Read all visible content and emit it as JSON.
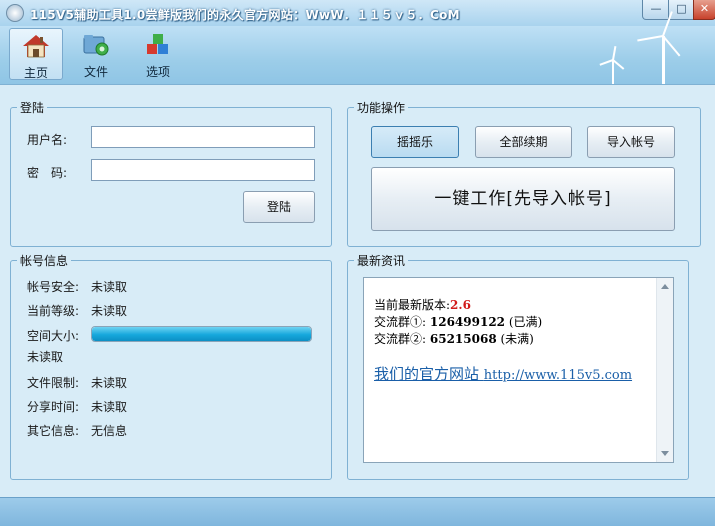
{
  "window": {
    "title": "115V5辅助工具1.0尝鲜版我们的永久官方网站：WwW．１１５ｖ５．CoM",
    "min_label": "—",
    "max_label": "□",
    "close_label": "✕"
  },
  "toolbar": {
    "items": [
      {
        "label": "主页",
        "icon": "house-icon",
        "active": true
      },
      {
        "label": "文件",
        "icon": "folder-gear-icon",
        "active": false
      },
      {
        "label": "选项",
        "icon": "blocks-icon",
        "active": false
      }
    ]
  },
  "login": {
    "title": "登陆",
    "username_label": "用户名:",
    "username_value": "",
    "password_label": "密　码:",
    "password_value": "",
    "login_button": "登陆"
  },
  "functions": {
    "title": "功能操作",
    "shake_button": "摇摇乐",
    "renew_all_button": "全部续期",
    "import_button": "导入帐号",
    "one_click_button": "一键工作[先导入帐号]"
  },
  "account": {
    "title": "帐号信息",
    "security_label": "帐号安全:",
    "security_value": "未读取",
    "level_label": "当前等级:",
    "level_value": "未读取",
    "space_label": "空间大小:",
    "space_value": "未读取",
    "space_progress": 1.0,
    "file_limit_label": "文件限制:",
    "file_limit_value": "未读取",
    "share_time_label": "分享时间:",
    "share_time_value": "未读取",
    "other_label": "其它信息:",
    "other_value": "无信息"
  },
  "news": {
    "title": "最新资讯",
    "version_label": "当前最新版本:",
    "version_value": "2.6",
    "group1_label": "交流群①:",
    "group1_value": "126499122",
    "group1_status": "(已满)",
    "group2_label": "交流群②:",
    "group2_value": "65215068",
    "group2_status": "(未满)",
    "site_label": "我们的官方网站",
    "site_url": "http://www.115v5.com"
  },
  "colors": {
    "accent": "#16a8dc",
    "version_red": "#d11a1a",
    "link_blue": "#1a5fa8"
  }
}
